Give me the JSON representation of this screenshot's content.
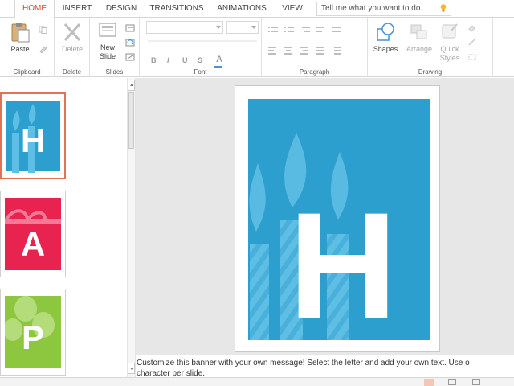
{
  "tabs": [
    {
      "label": "HOME",
      "active": true
    },
    {
      "label": "INSERT"
    },
    {
      "label": "DESIGN"
    },
    {
      "label": "TRANSITIONS"
    },
    {
      "label": "ANIMATIONS"
    },
    {
      "label": "VIEW"
    }
  ],
  "tell_me": {
    "placeholder": "Tell me what you want to do"
  },
  "ribbon": {
    "clipboard": {
      "paste_label": "Paste",
      "group_label": "Clipboard"
    },
    "delete": {
      "delete_label": "Delete",
      "group_label": "Delete"
    },
    "slides": {
      "new_slide_label_1": "New",
      "new_slide_label_2": "Slide",
      "group_label": "Slides"
    },
    "font": {
      "bold": "B",
      "italic": "I",
      "underline": "U",
      "strike": "S",
      "font_color": "A",
      "group_label": "Font"
    },
    "paragraph": {
      "group_label": "Paragraph"
    },
    "drawing": {
      "shapes_label": "Shapes",
      "arrange_label": "Arrange",
      "quick_label_1": "Quick",
      "quick_label_2": "Styles",
      "group_label": "Drawing"
    }
  },
  "thumbnails": [
    {
      "letter": "H",
      "color": "#2d9fce",
      "motif": "candles",
      "selected": true
    },
    {
      "letter": "A",
      "color": "#e8234f",
      "motif": "gift"
    },
    {
      "letter": "P",
      "color": "#8dc63f",
      "motif": "balloons"
    }
  ],
  "slide": {
    "letter": "H",
    "background": "#2d9fce",
    "candle_color": "#5ebee4"
  },
  "notes": {
    "line1": "Customize this banner with your own message! Select the letter and add your own text. Use o",
    "line2": "character per slide."
  },
  "colors": {
    "accent": "#d24726",
    "selection_border": "#e07255"
  }
}
